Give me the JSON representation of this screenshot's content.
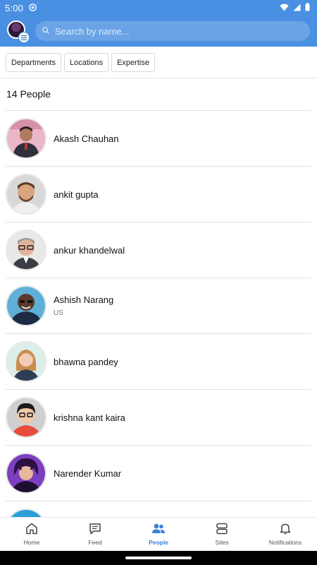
{
  "status": {
    "time": "5:00"
  },
  "search": {
    "placeholder": "Search by name..."
  },
  "filters": [
    "Departments",
    "Locations",
    "Expertise"
  ],
  "people_count": "14 People",
  "people": [
    {
      "name": "Akash Chauhan",
      "subtitle": ""
    },
    {
      "name": "ankit gupta",
      "subtitle": ""
    },
    {
      "name": "ankur khandelwal",
      "subtitle": ""
    },
    {
      "name": "Ashish Narang",
      "subtitle": "US"
    },
    {
      "name": "bhawna pandey",
      "subtitle": ""
    },
    {
      "name": "krishna kant kaira",
      "subtitle": ""
    },
    {
      "name": "Narender Kumar",
      "subtitle": ""
    }
  ],
  "nav": [
    {
      "label": "Home",
      "icon": "home-icon"
    },
    {
      "label": "Feed",
      "icon": "chat-icon"
    },
    {
      "label": "People",
      "icon": "people-icon",
      "active": true
    },
    {
      "label": "Sites",
      "icon": "sites-icon"
    },
    {
      "label": "Notifications",
      "icon": "bell-icon"
    }
  ],
  "colors": {
    "header": "#4a90e2",
    "active": "#3b82d6"
  }
}
